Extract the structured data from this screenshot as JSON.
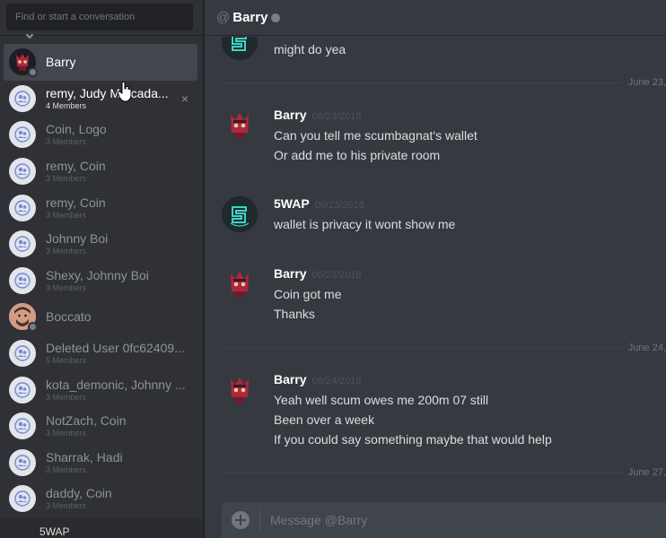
{
  "search": {
    "placeholder": "Find or start a conversation"
  },
  "header": {
    "at_symbol": "@",
    "title": "Barry"
  },
  "dm_list": [
    {
      "name": "Barry",
      "sub": "",
      "avatar": "barry-avatar"
    },
    {
      "name": "remy, Judy M...cada...",
      "sub": "4 Members",
      "avatar": "group-avatar",
      "close": "×"
    },
    {
      "name": "Coin, Logo",
      "sub": "3 Members",
      "avatar": "group-avatar"
    },
    {
      "name": "remy, Coin",
      "sub": "3 Members",
      "avatar": "group-avatar"
    },
    {
      "name": "remy, Coin",
      "sub": "3 Members",
      "avatar": "group-avatar"
    },
    {
      "name": "Johnny Boi",
      "sub": "3 Members",
      "avatar": "group-avatar"
    },
    {
      "name": "Shexy, Johnny Boi",
      "sub": "3 Members",
      "avatar": "group-avatar"
    },
    {
      "name": "Boccato",
      "sub": "",
      "avatar": "boccato-avatar"
    },
    {
      "name": "Deleted User 0fc62409...",
      "sub": "5 Members",
      "avatar": "group-avatar"
    },
    {
      "name": "kota_demonic, Johnny ...",
      "sub": "3 Members",
      "avatar": "group-avatar"
    },
    {
      "name": "NotZach, Coin",
      "sub": "3 Members",
      "avatar": "group-avatar"
    },
    {
      "name": "Sharrak, Hadi",
      "sub": "3 Members",
      "avatar": "group-avatar"
    },
    {
      "name": "daddy, Coin",
      "sub": "3 Members",
      "avatar": "group-avatar"
    }
  ],
  "sidebar_bottom": {
    "label": "5WAP"
  },
  "messages": {
    "partial_top": {
      "text": "might do yea"
    },
    "dates": [
      "June 23,",
      "June 24,",
      "June 27,"
    ],
    "groups": [
      {
        "author": "Barry",
        "time": "06/23/2018",
        "lines": [
          "Can you tell me scumbagnat's wallet",
          "Or add me to his private room"
        ]
      },
      {
        "author": "5WAP",
        "time": "06/23/2018",
        "lines": [
          "wallet is privacy it wont show me"
        ]
      },
      {
        "author": "Barry",
        "time": "06/23/2018",
        "lines": [
          "Coin got me",
          "Thanks"
        ]
      },
      {
        "author": "Barry",
        "time": "06/24/2018",
        "lines": [
          "Yeah well scum owes me 200m 07 still",
          "Been over a week",
          "If you could say something maybe that would help"
        ]
      }
    ]
  },
  "composer": {
    "placeholder": "Message @Barry"
  },
  "colors": {
    "background": "#36393f",
    "sidebar": "#2f3136",
    "selected": "#42464d",
    "composer": "#40444b",
    "status_offline": "#747f8d",
    "accent_teal": "#3ed3c9"
  }
}
